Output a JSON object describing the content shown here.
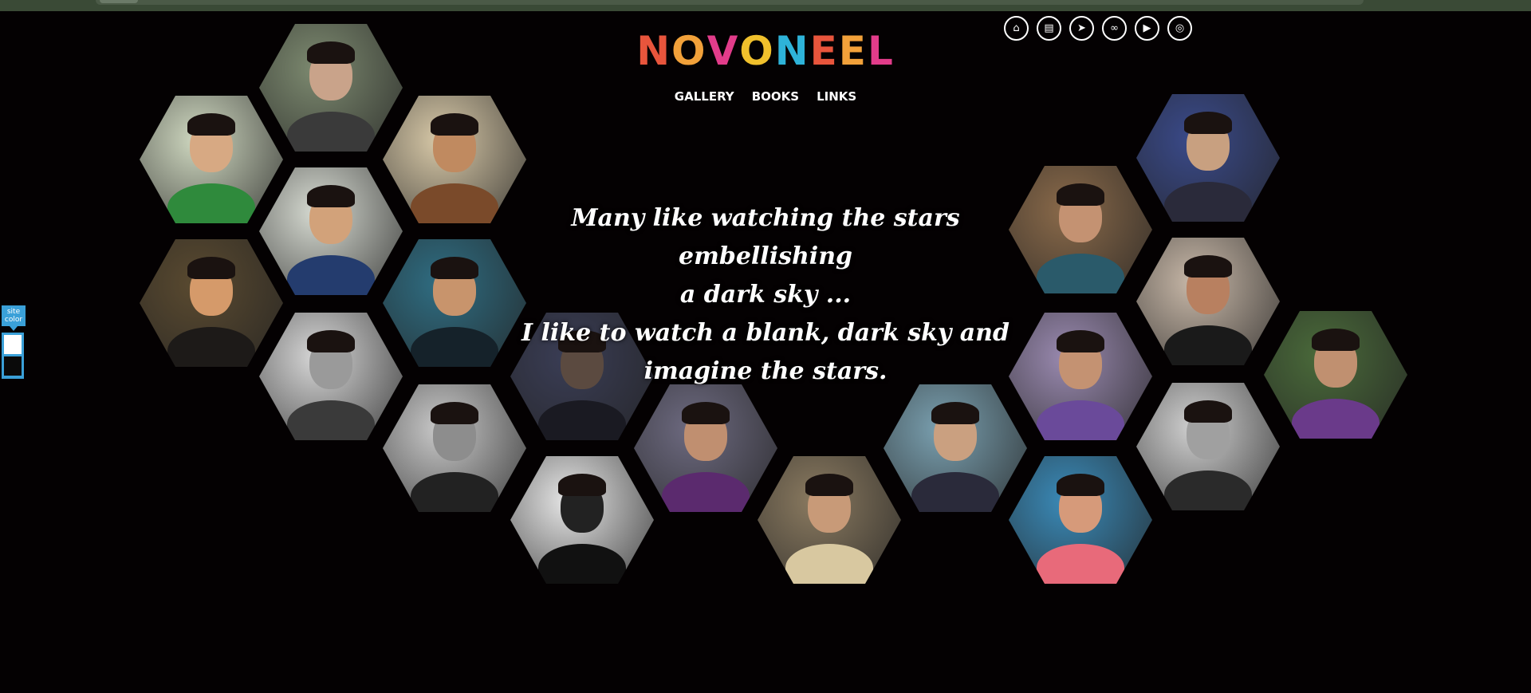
{
  "logo": {
    "letters": [
      "N",
      "O",
      "V",
      "O",
      "N",
      "E",
      "E",
      "L"
    ],
    "colors": [
      "#e8553c",
      "#f2a13a",
      "#e23c8a",
      "#f0c02c",
      "#2eb3d9",
      "#e8553c",
      "#f2a13a",
      "#e23c8a"
    ]
  },
  "nav": {
    "items": [
      {
        "label": "GALLERY"
      },
      {
        "label": "BOOKS"
      },
      {
        "label": "LINKS"
      }
    ]
  },
  "social": {
    "icons": [
      {
        "name": "home-icon",
        "glyph": "⌂"
      },
      {
        "name": "newspaper-icon",
        "glyph": "▤"
      },
      {
        "name": "telegram-icon",
        "glyph": "➤"
      },
      {
        "name": "link-icon",
        "glyph": "∞"
      },
      {
        "name": "youtube-icon",
        "glyph": "▶"
      },
      {
        "name": "instagram-icon",
        "glyph": "◎"
      }
    ]
  },
  "quote": {
    "line1": "Many like watching the stars embellishing",
    "line2": "a dark sky ...",
    "line3": "I like to watch a blank, dark sky and",
    "line4": "imagine the stars."
  },
  "site_color": {
    "label": "site color",
    "swatches": [
      "#ffffff",
      "#0a0a0a"
    ]
  },
  "colors": {
    "background": "#040102",
    "accent": "#3aa0d8"
  }
}
